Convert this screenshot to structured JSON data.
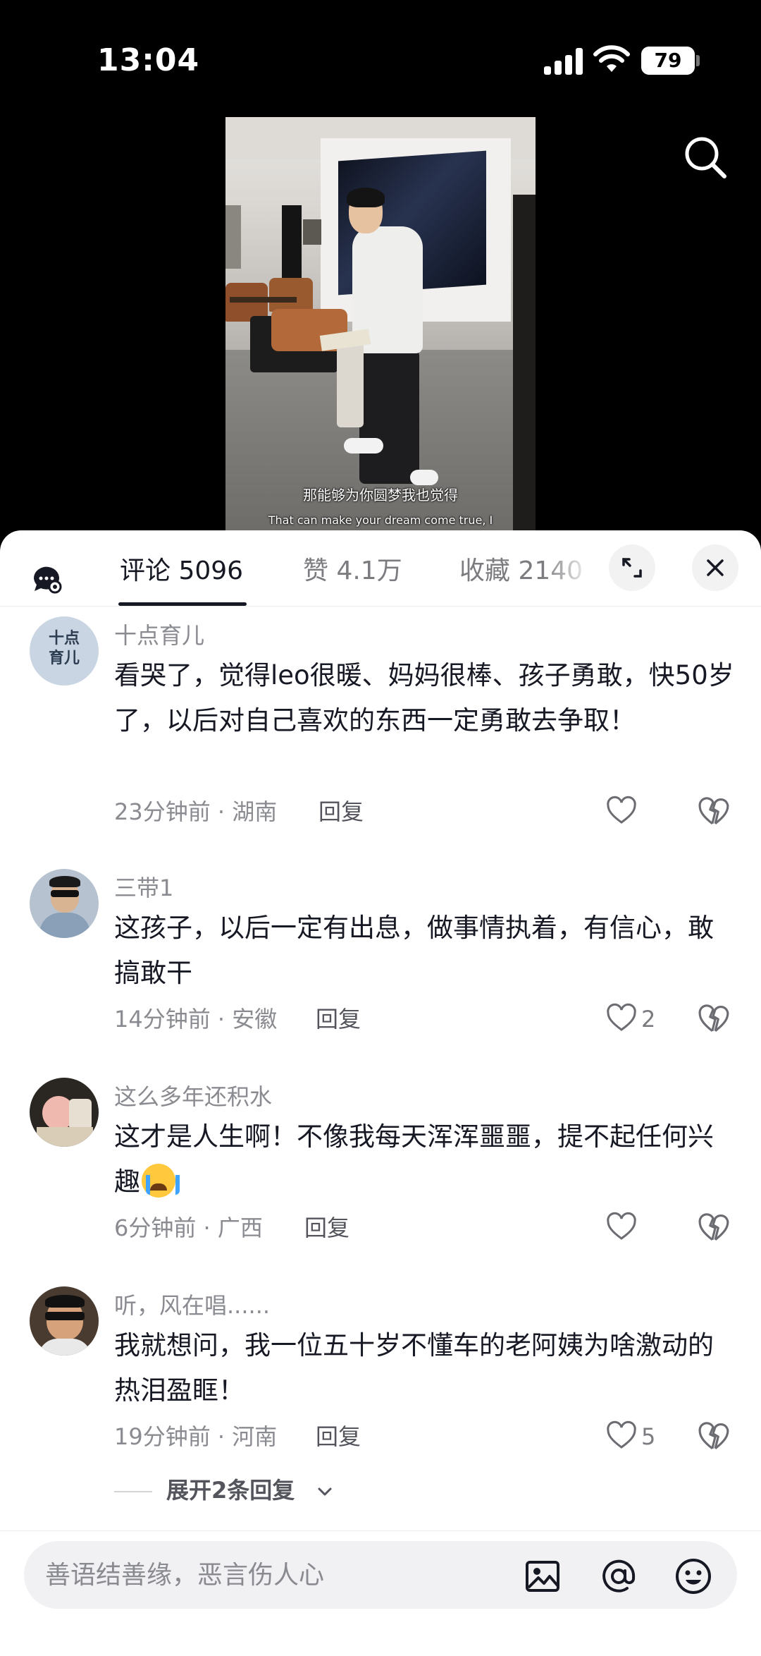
{
  "status_bar": {
    "time": "13:04",
    "battery": "79"
  },
  "video": {
    "subtitle_cn": "那能够为你圆梦我也觉得",
    "subtitle_en": "That can make your dream come true, I"
  },
  "tabs": [
    {
      "label": "评论 5096",
      "active": true
    },
    {
      "label": "赞 4.1万",
      "active": false
    },
    {
      "label": "收藏 2140",
      "active": false
    }
  ],
  "comments": [
    {
      "user": "十点育儿",
      "avatar_text": "十点育儿",
      "text": "看哭了，觉得leo很暖、妈妈很棒、孩子勇敢，快50岁了，以后对自己喜欢的东西一定勇敢去争取！",
      "meta": "23分钟前 · 湖南",
      "reply_label": "回复",
      "likes": ""
    },
    {
      "user": "三带1",
      "text": "这孩子，以后一定有出息，做事情执着，有信心，敢搞敢干",
      "meta": "14分钟前 · 安徽",
      "reply_label": "回复",
      "likes": "2"
    },
    {
      "user": "这么多年还积水",
      "text": "这才是人生啊！不像我每天浑浑噩噩，提不起任何兴趣",
      "meta": "6分钟前 · 广西",
      "reply_label": "回复",
      "likes": ""
    },
    {
      "user": "听，风在唱......",
      "text": "我就想问，我一位五十岁不懂车的老阿姨为啥激动的热泪盈眶！",
      "meta": "19分钟前 · 河南",
      "reply_label": "回复",
      "likes": "5"
    }
  ],
  "expand_replies": "展开2条回复",
  "input": {
    "placeholder": "善语结善缘，恶言伤人心"
  },
  "icons": {
    "search": "search-icon",
    "ai": "ai-assistant-icon",
    "expand": "expand-icon",
    "close": "close-icon",
    "like": "heart-icon",
    "dislike": "broken-heart-icon",
    "image": "image-icon",
    "mention": "at-icon",
    "emoji": "emoji-icon"
  },
  "colors": {
    "text": "#161823",
    "secondary": "#8a8b91",
    "background": "#ffffff"
  }
}
